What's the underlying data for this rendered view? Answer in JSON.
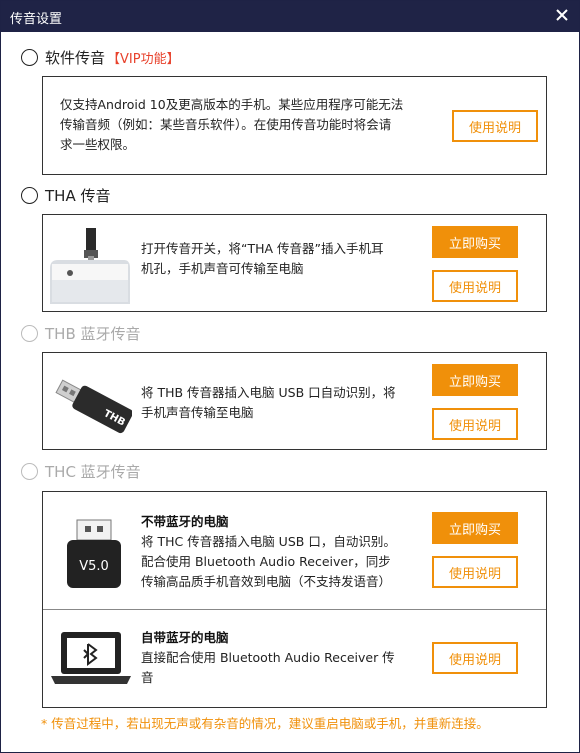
{
  "window": {
    "title": "传音设置"
  },
  "sections": {
    "software": {
      "label": "软件传音",
      "vip": "【VIP功能】",
      "desc_line1": "仅支持Android 10及更高版本的手机。某些应用程序可能无法",
      "desc_line2": "传输音频（例如：某些音乐软件）。在使用传音功能时将会请",
      "desc_line3": "求一些权限。",
      "instructions_label": "使用说明"
    },
    "tha": {
      "label": "THA 传音",
      "desc_line1": "打开传音开关，将“THA 传音器”插入手机耳",
      "desc_line2": "机孔，手机声音可传输至电脑",
      "buy_label": "立即购买",
      "instructions_label": "使用说明"
    },
    "thb": {
      "label": "THB 蓝牙传音",
      "desc_line1": "将 THB 传音器插入电脑 USB 口自动识别，将",
      "desc_line2": "手机声音传输至电脑",
      "device_text": "THB",
      "buy_label": "立即购买",
      "instructions_label": "使用说明"
    },
    "thc": {
      "label": "THC 蓝牙传音",
      "no_bt": {
        "heading": "不带蓝牙的电脑",
        "desc_line1": "将 THC 传音器插入电脑 USB 口，自动识别。",
        "desc_line2": "配合使用 Bluetooth Audio Receiver，同步",
        "desc_line3": "传输高品质手机音效到电脑（不支持发语音）",
        "device_text": "V5.0",
        "buy_label": "立即购买",
        "instructions_label": "使用说明"
      },
      "with_bt": {
        "heading": "自带蓝牙的电脑",
        "desc_line1": "直接配合使用 Bluetooth Audio Receiver 传",
        "desc_line2": "音",
        "instructions_label": "使用说明"
      }
    }
  },
  "footnote": "* 传音过程中，若出现无声或有杂音的情况，建议重启电脑或手机，并重新连接。",
  "colors": {
    "accent": "#f0900a",
    "titlebar": "#1f2346",
    "vip": "#e8422c"
  }
}
